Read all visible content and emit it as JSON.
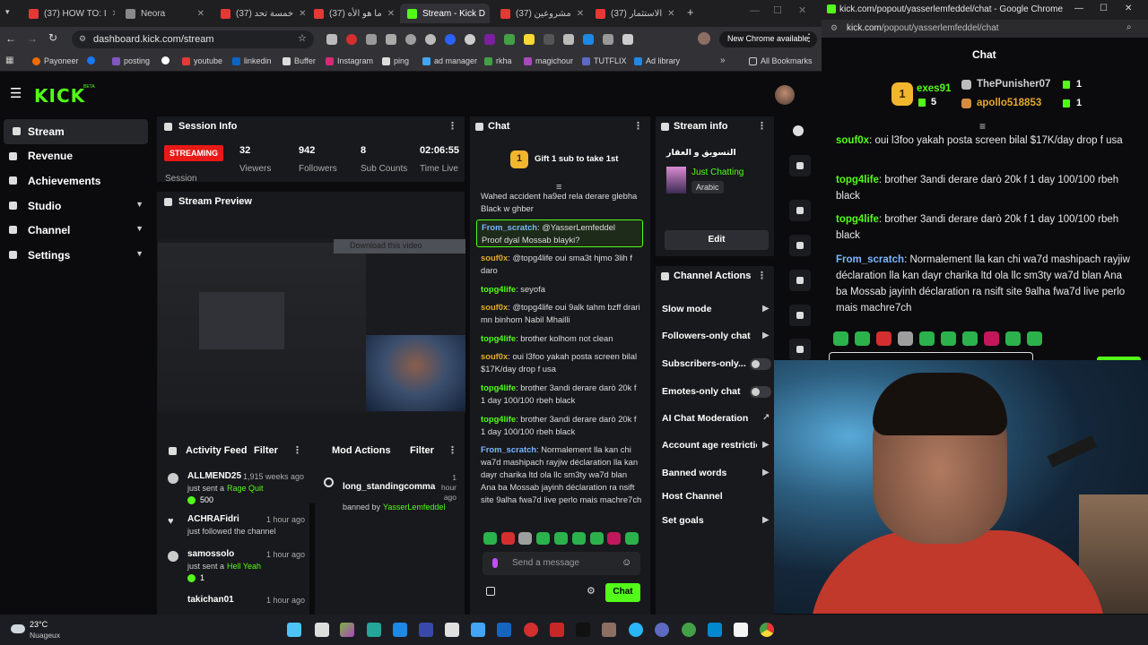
{
  "browser": {
    "tabs": [
      {
        "label": "(37) HOW TO: I"
      },
      {
        "label": "Neora"
      },
      {
        "label": "(37) خمسة تحد"
      },
      {
        "label": "(37) ما هو الأه"
      },
      {
        "label": "Stream - Kick D"
      },
      {
        "label": "(37) مشروعين"
      },
      {
        "label": "(37) الاستثمار"
      }
    ],
    "url": "dashboard.kick.com/stream",
    "new_chrome": "New Chrome available",
    "bookmarks": [
      "Payoneer",
      "posting",
      "youtube",
      "linkedin",
      "Buffer",
      "Instagram",
      "ping",
      "ad manager",
      "rkha",
      "magichour",
      "TUTFLIX",
      "Ad library"
    ],
    "all_bookmarks": "All Bookmarks"
  },
  "kick": {
    "logo": "KICK",
    "beta": "BETA",
    "nav": [
      {
        "label": "Stream"
      },
      {
        "label": "Revenue"
      },
      {
        "label": "Achievements"
      },
      {
        "label": "Studio"
      },
      {
        "label": "Channel"
      },
      {
        "label": "Settings"
      }
    ],
    "session": {
      "title": "Session Info",
      "status": "STREAMING",
      "session_label": "Session",
      "viewers": "32",
      "viewers_label": "Viewers",
      "followers": "942",
      "followers_label": "Followers",
      "subs": "8",
      "subs_label": "Sub Counts",
      "time": "02:06:55",
      "time_label": "Time Live"
    },
    "preview": {
      "title": "Stream Preview",
      "download": "Download this video"
    },
    "activity": {
      "title": "Activity Feed",
      "filter": "Filter",
      "items": [
        {
          "user": "ALLMEND25",
          "time": "1,915 weeks ago",
          "text": "just sent a",
          "highlight": "Rage Quit",
          "amount": "500"
        },
        {
          "user": "ACHRAFidri",
          "time": "1 hour ago",
          "text": "just followed the channel"
        },
        {
          "user": "samossolo",
          "time": "1 hour ago",
          "text": "just sent a",
          "highlight": "Hell Yeah",
          "amount": "1"
        },
        {
          "user": "takichan01",
          "time": "1 hour ago"
        }
      ]
    },
    "mod": {
      "title": "Mod Actions",
      "filter": "Filter",
      "user": "long_standingcommar",
      "time": "1 hour ago",
      "banned_by": "banned by",
      "moderator": "YasserLemfeddel"
    },
    "chat": {
      "title": "Chat",
      "gift": "Gift 1 sub to take 1st",
      "gift_count": "1",
      "messages": [
        {
          "user": "",
          "text": "Wahed accident ha9ed rela derare glebha Black w ghber"
        },
        {
          "user": "From_scratch",
          "text": "@YasserLemfeddel Proof dyal Mossab blayki?"
        },
        {
          "user": "souf0x",
          "text": "@topg4life oui sma3t hjmo 3lih f daro"
        },
        {
          "user": "topg4life",
          "text": "seyofa"
        },
        {
          "user": "souf0x",
          "text": "@topg4life oui 9alk tahm bzff drari mn binhom Nabil Mhailli"
        },
        {
          "user": "topg4life",
          "text": "brother kolhom not clean"
        },
        {
          "user": "souf0x",
          "text": "oui l3foo yakah posta screen bilal $17K/day drop f usa"
        },
        {
          "user": "topg4life",
          "text": "brother 3andi derare darò 20k f 1 day 100/100 rbeh black"
        },
        {
          "user": "topg4life",
          "text": "brother 3andi derare darò 20k f 1 day 100/100 rbeh black"
        },
        {
          "user": "From_scratch",
          "text": "Normalement lla kan chi wa7d mashipach rayjiw déclaration lla kan dayr charika ltd ola llc sm3ty wa7d blan Ana ba Mossab jayinh déclaration ra nsift site 9alha fwa7d live perlo mais machre7ch"
        }
      ],
      "placeholder": "Send a message",
      "send": "Chat"
    },
    "stream_info": {
      "title": "Stream info",
      "stream_title": "التسويق و العقار",
      "category": "Just Chatting",
      "language": "Arabic",
      "edit": "Edit"
    },
    "channel_actions": {
      "title": "Channel Actions",
      "items": [
        {
          "label": "Slow mode"
        },
        {
          "label": "Followers-only chat"
        },
        {
          "label": "Subscribers-only..."
        },
        {
          "label": "Emotes-only chat"
        },
        {
          "label": "AI Chat Moderation"
        },
        {
          "label": "Account age restriction"
        },
        {
          "label": "Banned words"
        },
        {
          "label": "Host Channel"
        },
        {
          "label": "Set goals"
        }
      ]
    }
  },
  "popout": {
    "window_title": "kick.com/popout/yasserlemfeddel/chat - Google Chrome",
    "url_host": "kick.com",
    "url_path": "/popout/yasserlemfeddel/chat",
    "header": "Chat",
    "leaders": [
      {
        "rank": "1",
        "name": "exes91",
        "count": "5"
      },
      {
        "name": "ThePunisher07",
        "count": "1"
      },
      {
        "name": "apollo518853",
        "count": "1"
      }
    ],
    "messages": [
      {
        "user": "souf0x",
        "text": "oui l3foo yakah posta screen bilal $17K/day drop f usa"
      },
      {
        "user": "topg4life",
        "text": "brother 3andi derare darò 20k f 1 day 100/100 rbeh black"
      },
      {
        "user": "topg4life",
        "text": "brother 3andi derare darò 20k f 1 day 100/100 rbeh black"
      },
      {
        "user": "From_scratch",
        "text": "Normalement lla kan chi wa7d mashipach rayjiw déclaration lla kan dayr charika ltd ola llc sm3ty wa7d blan Ana ba Mossab jayinh déclaration ra nsift site 9alha fwa7d live perlo mais machre7ch"
      }
    ]
  },
  "taskbar": {
    "temp": "23°C",
    "weather": "Nuageux"
  },
  "colors": {
    "kick_green": "#53fc18",
    "streaming_red": "#e91916",
    "panel": "#18191c"
  }
}
